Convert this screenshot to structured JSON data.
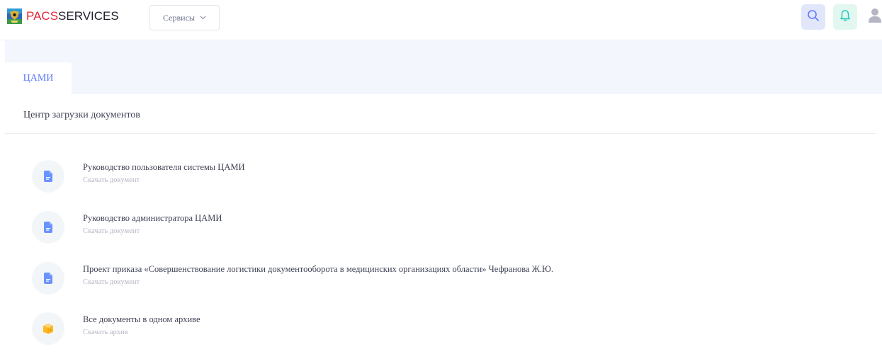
{
  "header": {
    "logo_part1": "PACS",
    "logo_part2": "SERVICES",
    "services_label": "Сервисы",
    "icons": [
      "search-icon",
      "bell-icon",
      "user-icon"
    ],
    "colors": {
      "logo_red": "#e3263c",
      "accent": "#5d78ff",
      "search_bg": "#e1e6fb",
      "bell_bg": "#e2f7ef"
    }
  },
  "tabs": [
    {
      "label": "ЦАМИ",
      "active": true
    }
  ],
  "card": {
    "title": "Центр загрузки документов",
    "items": [
      {
        "title": "Руководство пользователя системы ЦАМИ",
        "action": "Скачать документ",
        "icon": "document-icon"
      },
      {
        "title": "Руководство администратора ЦАМИ",
        "action": "Скачать документ",
        "icon": "document-icon"
      },
      {
        "title": "Проект приказа «Совершенствование логистики документооборота в медицинских организациях области» Чефранова Ж.Ю.",
        "action": "Скачать документ",
        "icon": "document-icon"
      },
      {
        "title": "Все документы в одном архиве",
        "action": "Скачать архив",
        "icon": "archive-box-icon"
      }
    ]
  }
}
